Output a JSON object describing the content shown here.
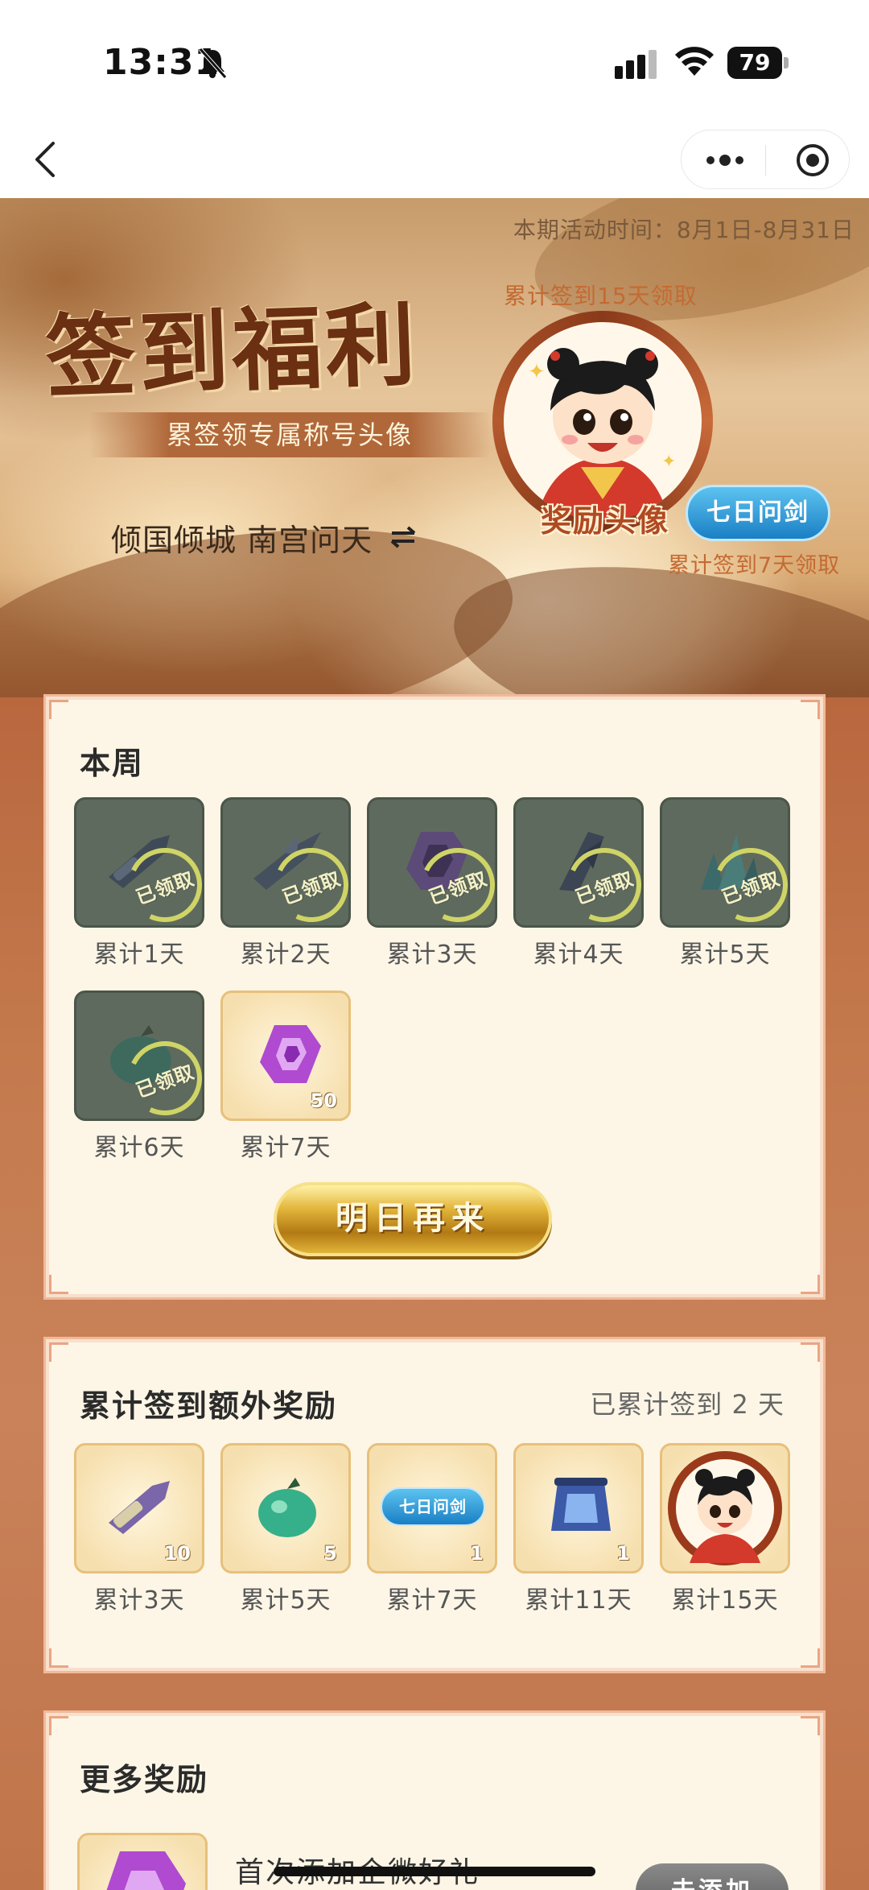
{
  "status_bar": {
    "time": "13:31",
    "battery": "79"
  },
  "hero": {
    "activity_time": "本期活动时间：8月1日-8月31日",
    "title": "签到福利",
    "subtitle": "累签领专属称号头像",
    "account_name": "倾国倾城 南宫问天",
    "avatar_tip": "累计签到15天领取",
    "avatar_label": "奖励头像",
    "title_badge": "七日问剑",
    "title_tip": "累计签到7天领取"
  },
  "week": {
    "title": "本周",
    "claimed_text": "已领取",
    "tiles": [
      {
        "label": "累计1天",
        "claimed": true
      },
      {
        "label": "累计2天",
        "claimed": true
      },
      {
        "label": "累计3天",
        "claimed": true
      },
      {
        "label": "累计4天",
        "claimed": true
      },
      {
        "label": "累计5天",
        "claimed": true
      },
      {
        "label": "累计6天",
        "claimed": true
      },
      {
        "label": "累计7天",
        "claimed": false,
        "count": "50"
      }
    ],
    "button": "明日再来"
  },
  "extra": {
    "title": "累计签到额外奖励",
    "progress": "已累计签到 2 天",
    "tiles": [
      {
        "label": "累计3天",
        "count": "10"
      },
      {
        "label": "累计5天",
        "count": "5"
      },
      {
        "label": "累计7天",
        "count": "1",
        "badge": "七日问剑"
      },
      {
        "label": "累计11天",
        "count": "1"
      },
      {
        "label": "累计15天",
        "count": ""
      }
    ]
  },
  "more": {
    "title": "更多奖励",
    "gift_text": "首次添加企微好礼",
    "gift_button": "去添加"
  },
  "colors": {
    "accent_brown": "#b9673e",
    "claimed_gray": "#5f6a5e",
    "gold": "#e2b43a",
    "badge_blue": "#1a7fc4"
  }
}
